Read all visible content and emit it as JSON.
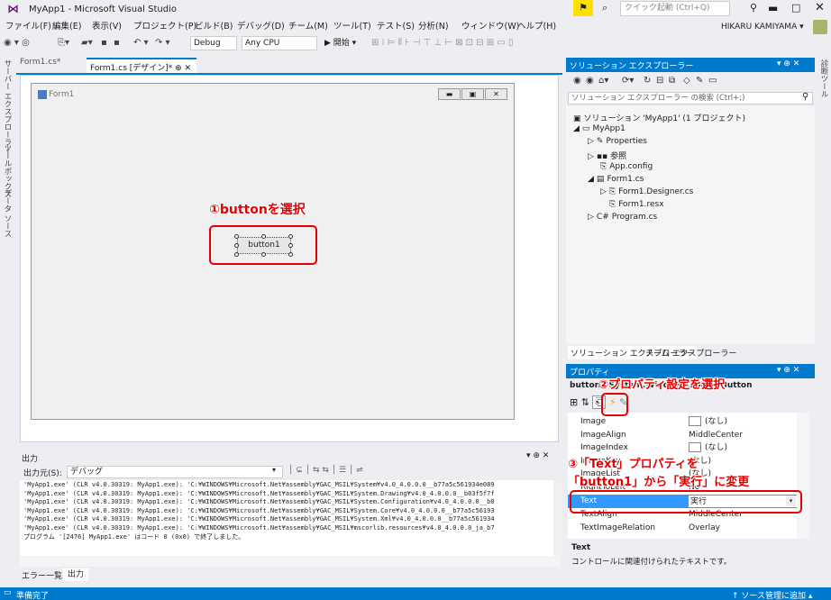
{
  "window": {
    "title": "MyApp1 - Microsoft Visual Studio",
    "quick_launch_placeholder": "クイック起動 (Ctrl+Q)",
    "user": "HIKARU KAMIYAMA ▾"
  },
  "menu": [
    "ファイル(F)",
    "編集(E)",
    "表示(V)",
    "プロジェクト(P)",
    "ビルド(B)",
    "デバッグ(D)",
    "チーム(M)",
    "ツール(T)",
    "テスト(S)",
    "分析(N)",
    "ウィンドウ(W)",
    "ヘルプ(H)"
  ],
  "toolbar": {
    "config": "Debug",
    "platform": "Any CPU",
    "start_label": "▶ 開始 ▾"
  },
  "left_rail": [
    "サーバー エクスプローラー",
    "ツールボックス",
    "データ ソース"
  ],
  "right_rail": "診断ツール",
  "tabs": {
    "form1cs": "Form1.cs*",
    "designer": "Form1.cs [デザイン]*  ⊕ ✕"
  },
  "designer": {
    "form_title": "Form1",
    "button_text": "button1"
  },
  "annotations": {
    "step1": "①buttonを選択",
    "step2": "②プロパティ設定を選択",
    "step3_line1": "③「Text」プロパティを",
    "step3_line2": "「button1」から「実行」に変更"
  },
  "output": {
    "title": "出力",
    "source_label": "出力元(S):",
    "source_value": "デバッグ",
    "lines": [
      "'MyApp1.exe' (CLR v4.0.30319: MyApp1.exe): 'C:¥WINDOWS¥Microsoft.Net¥assembly¥GAC_MSIL¥System¥v4.0_4.0.0.0__b77a5c561934e089",
      "'MyApp1.exe' (CLR v4.0.30319: MyApp1.exe): 'C:¥WINDOWS¥Microsoft.Net¥assembly¥GAC_MSIL¥System.Drawing¥v4.0_4.0.0.0__b03f5f7f",
      "'MyApp1.exe' (CLR v4.0.30319: MyApp1.exe): 'C:¥WINDOWS¥Microsoft.Net¥assembly¥GAC_MSIL¥System.Configuration¥v4.0_4.0.0.0__b0",
      "'MyApp1.exe' (CLR v4.0.30319: MyApp1.exe): 'C:¥WINDOWS¥Microsoft.Net¥assembly¥GAC_MSIL¥System.Core¥v4.0_4.0.0.0__b77a5c56193",
      "'MyApp1.exe' (CLR v4.0.30319: MyApp1.exe): 'C:¥WINDOWS¥Microsoft.Net¥assembly¥GAC_MSIL¥System.Xml¥v4.0_4.0.0.0__b77a5c561934",
      "'MyApp1.exe' (CLR v4.0.30319: MyApp1.exe): 'C:¥WINDOWS¥Microsoft.Net¥assembly¥GAC_MSIL¥mscorlib.resources¥v4.0_4.0.0.0_ja_b7",
      "プログラム '[2476] MyApp1.exe' はコード 0 (0x0) で終了しました。"
    ],
    "tab_errors": "エラー一覧",
    "tab_output": "出力"
  },
  "solution_explorer": {
    "title": "ソリューション エクスプローラー",
    "controls": "▾ ⊕ ✕",
    "search_placeholder": "ソリューション エクスプローラー の検索 (Ctrl+;)",
    "tree": [
      "ソリューション 'MyApp1' (1 プロジェクト)",
      "MyApp1",
      "Properties",
      "参照",
      "App.config",
      "Form1.cs",
      "Form1.Designer.cs",
      "Form1.resx",
      "Program.cs"
    ],
    "tab_solution": "ソリューション エクスプローラー",
    "tab_team": "チーム エクスプローラー"
  },
  "properties": {
    "title": "プロパティ",
    "object": "button1  System.Windows.Forms.Button",
    "rows": [
      {
        "name": "Image",
        "value": "(なし)"
      },
      {
        "name": "ImageAlign",
        "value": "MiddleCenter"
      },
      {
        "name": "ImageIndex",
        "value": "(なし)"
      },
      {
        "name": "ImageKey",
        "value": "(なし)"
      },
      {
        "name": "ImageList",
        "value": "(なし)"
      },
      {
        "name": "RightToLeft",
        "value": "No"
      },
      {
        "name": "Text",
        "value": "実行"
      },
      {
        "name": "TextAlign",
        "value": "MiddleCenter"
      },
      {
        "name": "TextImageRelation",
        "value": "Overlay"
      }
    ],
    "desc_title": "Text",
    "desc_text": "コントロールに関連付けられたテキストです。"
  },
  "status": {
    "left": "準備完了",
    "right": "↑ ソース管理に追加 ▴"
  },
  "colors": {
    "accent": "#007acc",
    "annotation": "#e60000"
  }
}
